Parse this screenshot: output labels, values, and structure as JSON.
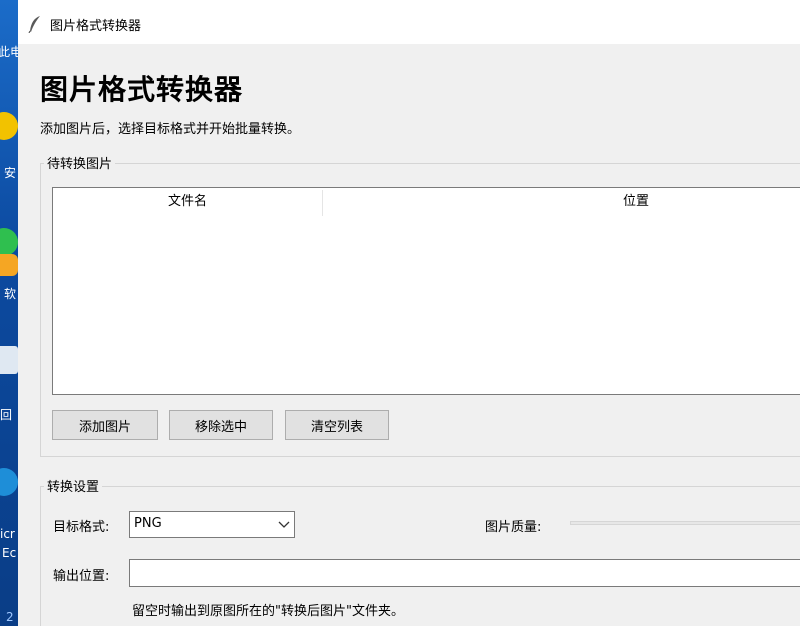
{
  "desktop": {
    "labels": [
      "此电",
      "安",
      "软",
      "回",
      "icr",
      "Ec",
      "2"
    ]
  },
  "window": {
    "title": "图片格式转换器"
  },
  "main": {
    "heading": "图片格式转换器",
    "subtitle": "添加图片后，选择目标格式并开始批量转换。"
  },
  "pending": {
    "group_title": "待转换图片",
    "columns": [
      "文件名",
      "位置"
    ],
    "rows": [],
    "buttons": {
      "add": "添加图片",
      "remove": "移除选中",
      "clear": "清空列表"
    }
  },
  "settings": {
    "group_title": "转换设置",
    "format_label": "目标格式:",
    "format_value": "PNG",
    "quality_label": "图片质量:",
    "output_label": "输出位置:",
    "output_value": "",
    "output_hint": "留空时输出到原图所在的\"转换后图片\"文件夹。"
  },
  "colors": {
    "window_bg": "#f0f0f0",
    "titlebar_bg": "#ffffff",
    "desktop_bg": "#0b3f86"
  }
}
